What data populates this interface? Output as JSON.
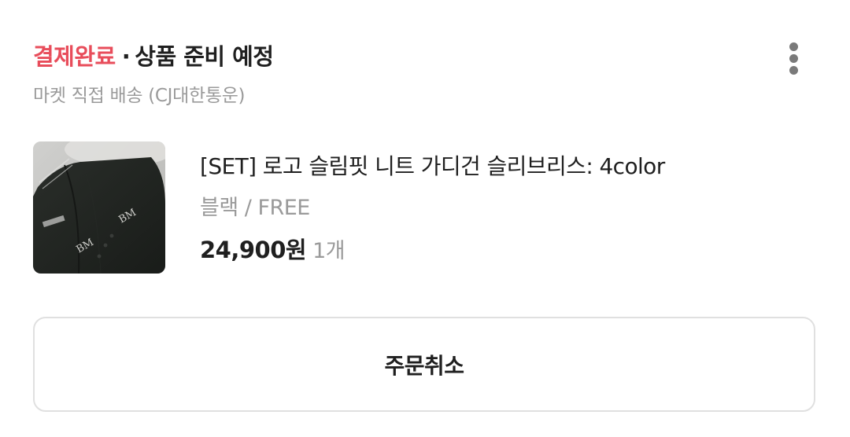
{
  "order": {
    "status_primary": "결제완료",
    "status_separator": "·",
    "status_secondary": "상품 준비 예정",
    "delivery": "마켓 직접 배송 (CJ대한통운)"
  },
  "more_menu": {
    "icon": "more-vertical-icon"
  },
  "product": {
    "name": "[SET] 로고 슬림핏 니트 가디건 슬리브리스: 4color",
    "option": "블랙 / FREE",
    "price": "24,900원",
    "quantity": "1개"
  },
  "actions": {
    "cancel_label": "주문취소"
  },
  "colors": {
    "status_accent": "#e84d5b",
    "muted_text": "#9a9a9a",
    "primary_text": "#1f1f1f",
    "button_border": "#e0e0e0"
  }
}
